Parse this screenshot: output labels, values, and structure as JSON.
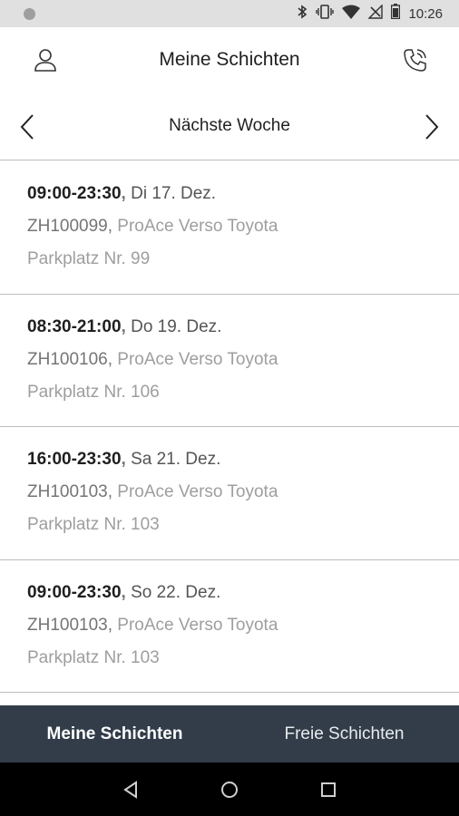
{
  "status_bar": {
    "time": "10:26",
    "icons": [
      "bluetooth-icon",
      "vibrate-icon",
      "wifi-icon",
      "no-signal-icon",
      "battery-icon"
    ]
  },
  "header": {
    "title": "Meine Schichten",
    "left_icon": "profile-icon",
    "right_icon": "phone-call-icon"
  },
  "week_nav": {
    "label": "Nächste Woche",
    "prev_icon": "chevron-left-icon",
    "next_icon": "chevron-right-icon"
  },
  "shifts": [
    {
      "time": "09:00-23:30",
      "date": "Di 17. Dez.",
      "plate": "ZH100099",
      "vehicle": "ProAce Verso Toyota",
      "parking": "Parkplatz Nr. 99"
    },
    {
      "time": "08:30-21:00",
      "date": "Do 19. Dez.",
      "plate": "ZH100106",
      "vehicle": "ProAce Verso Toyota",
      "parking": "Parkplatz Nr. 106"
    },
    {
      "time": "16:00-23:30",
      "date": "Sa 21. Dez.",
      "plate": "ZH100103",
      "vehicle": "ProAce Verso Toyota",
      "parking": "Parkplatz Nr. 103"
    },
    {
      "time": "09:00-23:30",
      "date": "So 22. Dez.",
      "plate": "ZH100103",
      "vehicle": "ProAce Verso Toyota",
      "parking": "Parkplatz Nr. 103"
    }
  ],
  "bottom_nav": {
    "tabs": [
      {
        "label": "Meine Schichten",
        "active": true
      },
      {
        "label": "Freie Schichten",
        "active": false
      }
    ]
  },
  "system_nav": {
    "icons": [
      "back-icon",
      "home-icon",
      "recents-icon"
    ]
  },
  "colors": {
    "bottom_nav_bg": "#323d49",
    "status_bar_bg": "#e0e0e0",
    "divider": "#bdbdbd"
  }
}
